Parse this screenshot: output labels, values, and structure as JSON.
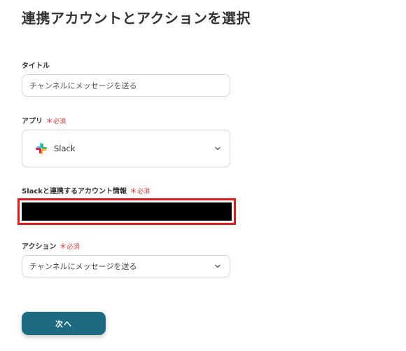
{
  "page": {
    "title": "連携アカウントとアクションを選択"
  },
  "form": {
    "title_field": {
      "label": "タイトル",
      "value": "チャンネルにメッセージを送る"
    },
    "app_field": {
      "label": "アプリ",
      "required": "必須",
      "value": "Slack",
      "icon": "slack-logo"
    },
    "account_field": {
      "label": "Slackと連携するアカウント情報",
      "required": "必須"
    },
    "action_field": {
      "label": "アクション",
      "required": "必須",
      "value": "チャンネルにメッセージを送る"
    }
  },
  "buttons": {
    "next": "次へ"
  },
  "colors": {
    "primary": "#1d6b80",
    "required": "#e23b3b",
    "redaction_border": "#e11b1b"
  }
}
